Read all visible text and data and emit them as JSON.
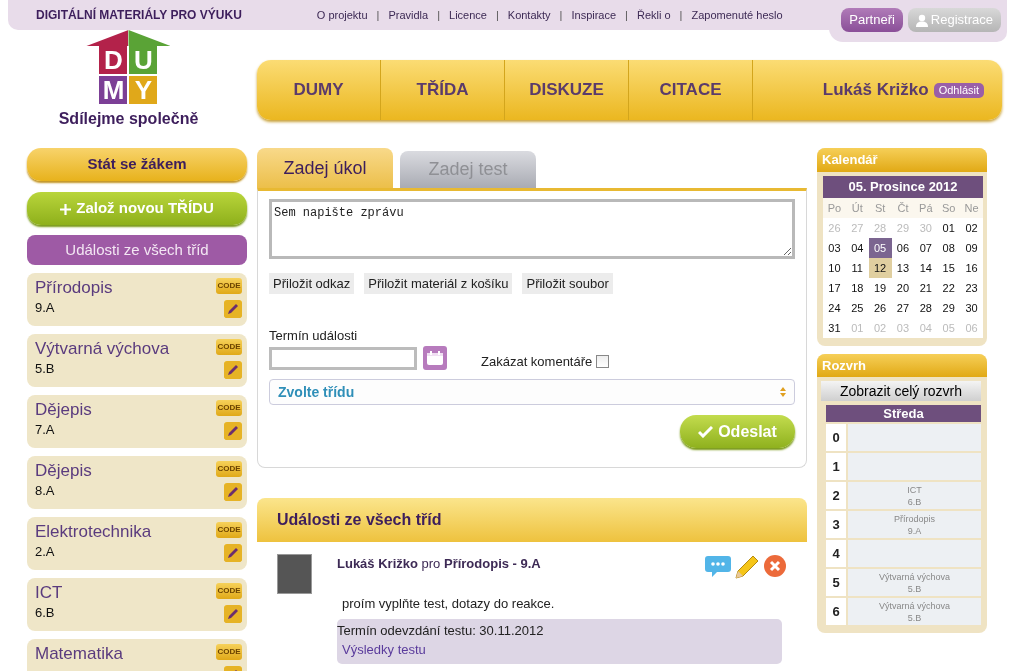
{
  "top_bar": {
    "site_title": "DIGITÁLNÍ MATERIÁLY PRO VÝUKU",
    "links": [
      "O projektu",
      "Pravidla",
      "Licence",
      "Kontakty",
      "Inspirace",
      "Řekli o",
      "Zapomenuté heslo"
    ],
    "separator": "|",
    "buttons": [
      {
        "label": "Partneři",
        "kind": "primary"
      },
      {
        "label": "Registrace",
        "kind": "muted"
      }
    ]
  },
  "logo": {
    "letters": [
      "D",
      "U",
      "M",
      "Y"
    ],
    "tagline": "Sdílejme společně"
  },
  "main_nav": {
    "items": [
      "DUMY",
      "TŘÍDA",
      "DISKUZE",
      "CITACE"
    ],
    "user": "Lukáš Križko",
    "logout": "Odhlásit"
  },
  "sidebar": {
    "join_button": "Stát se žákem",
    "new_class_button": "Založ novou TŘÍDU",
    "all_events_button": "Události ze všech tříd",
    "classes": [
      {
        "subject": "Přírodopis",
        "class": "9.A",
        "code_label": "CODE"
      },
      {
        "subject": "Výtvarná výchova",
        "class": "5.B",
        "code_label": "CODE"
      },
      {
        "subject": "Dějepis",
        "class": "7.A",
        "code_label": "CODE"
      },
      {
        "subject": "Dějepis",
        "class": "8.A",
        "code_label": "CODE"
      },
      {
        "subject": "Elektrotechnika",
        "class": "2.A",
        "code_label": "CODE"
      },
      {
        "subject": "ICT",
        "class": "6.B",
        "code_label": "CODE"
      },
      {
        "subject": "Matematika",
        "code_label": "CODE"
      }
    ]
  },
  "composer": {
    "tabs": [
      {
        "label": "Zadej úkol",
        "selected": true
      },
      {
        "label": "Zadej test",
        "selected": false
      }
    ],
    "message": "Sem napište zprávu",
    "attach_buttons": [
      "Přiložit odkaz",
      "Přiložit materiál z košíku",
      "Přiložit soubor"
    ],
    "deadline_label": "Termín události",
    "disable_comments_label": "Zakázat komentáře",
    "disable_comments_checked": false,
    "class_select": "Zvolte třídu",
    "send_button": "Odeslat"
  },
  "events": {
    "title": "Události ze všech tříd",
    "items": [
      {
        "author": "Lukáš Križko",
        "for_word": "pro",
        "target": "Přírodopis - 9.A",
        "text": "proím vyplňte test, dotazy do reakce.",
        "deadline": "Termín odevzdání testu: 30.11.2012",
        "results_link": "Výsledky testu"
      }
    ]
  },
  "calendar": {
    "title": "Kalendář",
    "heading": "05. Prosince  2012",
    "weekdays": [
      "Po",
      "Út",
      "St",
      "Čt",
      "Pá",
      "So",
      "Ne"
    ],
    "weeks": [
      [
        {
          "day": "26",
          "other_month": true,
          "selected": false,
          "marked": false
        },
        {
          "day": "27",
          "other_month": true,
          "selected": false,
          "marked": false
        },
        {
          "day": "28",
          "other_month": true,
          "selected": false,
          "marked": false
        },
        {
          "day": "29",
          "other_month": true,
          "selected": false,
          "marked": false
        },
        {
          "day": "30",
          "other_month": true,
          "selected": false,
          "marked": false
        },
        {
          "day": "01",
          "other_month": false,
          "selected": false,
          "marked": false
        },
        {
          "day": "02",
          "other_month": false,
          "selected": false,
          "marked": false
        }
      ],
      [
        {
          "day": "03",
          "other_month": false,
          "selected": false,
          "marked": false
        },
        {
          "day": "04",
          "other_month": false,
          "selected": false,
          "marked": false
        },
        {
          "day": "05",
          "other_month": false,
          "selected": true,
          "marked": false
        },
        {
          "day": "06",
          "other_month": false,
          "selected": false,
          "marked": false
        },
        {
          "day": "07",
          "other_month": false,
          "selected": false,
          "marked": false
        },
        {
          "day": "08",
          "other_month": false,
          "selected": false,
          "marked": false
        },
        {
          "day": "09",
          "other_month": false,
          "selected": false,
          "marked": false
        }
      ],
      [
        {
          "day": "10",
          "other_month": false,
          "selected": false,
          "marked": false
        },
        {
          "day": "11",
          "other_month": false,
          "selected": false,
          "marked": false
        },
        {
          "day": "12",
          "other_month": false,
          "selected": false,
          "marked": true
        },
        {
          "day": "13",
          "other_month": false,
          "selected": false,
          "marked": false
        },
        {
          "day": "14",
          "other_month": false,
          "selected": false,
          "marked": false
        },
        {
          "day": "15",
          "other_month": false,
          "selected": false,
          "marked": false
        },
        {
          "day": "16",
          "other_month": false,
          "selected": false,
          "marked": false
        }
      ],
      [
        {
          "day": "17",
          "other_month": false,
          "selected": false,
          "marked": false
        },
        {
          "day": "18",
          "other_month": false,
          "selected": false,
          "marked": false
        },
        {
          "day": "19",
          "other_month": false,
          "selected": false,
          "marked": false
        },
        {
          "day": "20",
          "other_month": false,
          "selected": false,
          "marked": false
        },
        {
          "day": "21",
          "other_month": false,
          "selected": false,
          "marked": false
        },
        {
          "day": "22",
          "other_month": false,
          "selected": false,
          "marked": false
        },
        {
          "day": "23",
          "other_month": false,
          "selected": false,
          "marked": false
        }
      ],
      [
        {
          "day": "24",
          "other_month": false,
          "selected": false,
          "marked": false
        },
        {
          "day": "25",
          "other_month": false,
          "selected": false,
          "marked": false
        },
        {
          "day": "26",
          "other_month": false,
          "selected": false,
          "marked": false
        },
        {
          "day": "27",
          "other_month": false,
          "selected": false,
          "marked": false
        },
        {
          "day": "28",
          "other_month": false,
          "selected": false,
          "marked": false
        },
        {
          "day": "29",
          "other_month": false,
          "selected": false,
          "marked": false
        },
        {
          "day": "30",
          "other_month": false,
          "selected": false,
          "marked": false
        }
      ],
      [
        {
          "day": "31",
          "other_month": false,
          "selected": false,
          "marked": false
        },
        {
          "day": "01",
          "other_month": true,
          "selected": false,
          "marked": false
        },
        {
          "day": "02",
          "other_month": true,
          "selected": false,
          "marked": false
        },
        {
          "day": "03",
          "other_month": true,
          "selected": false,
          "marked": false
        },
        {
          "day": "04",
          "other_month": true,
          "selected": false,
          "marked": false
        },
        {
          "day": "05",
          "other_month": true,
          "selected": false,
          "marked": false
        },
        {
          "day": "06",
          "other_month": true,
          "selected": false,
          "marked": false
        }
      ]
    ]
  },
  "schedule": {
    "title": "Rozvrh",
    "show_all_button": "Zobrazit celý rozvrh",
    "day": "Středa",
    "rows": [
      {
        "period": "0"
      },
      {
        "period": "1"
      },
      {
        "period": "2",
        "subject": "ICT",
        "class": "6.B"
      },
      {
        "period": "3",
        "subject": "Přírodopis",
        "class": "9.A"
      },
      {
        "period": "4"
      },
      {
        "period": "5",
        "subject": "Výtvarná výchova",
        "class": "5.B"
      },
      {
        "period": "6",
        "subject": "Výtvarná výchova",
        "class": "5.B"
      }
    ]
  }
}
